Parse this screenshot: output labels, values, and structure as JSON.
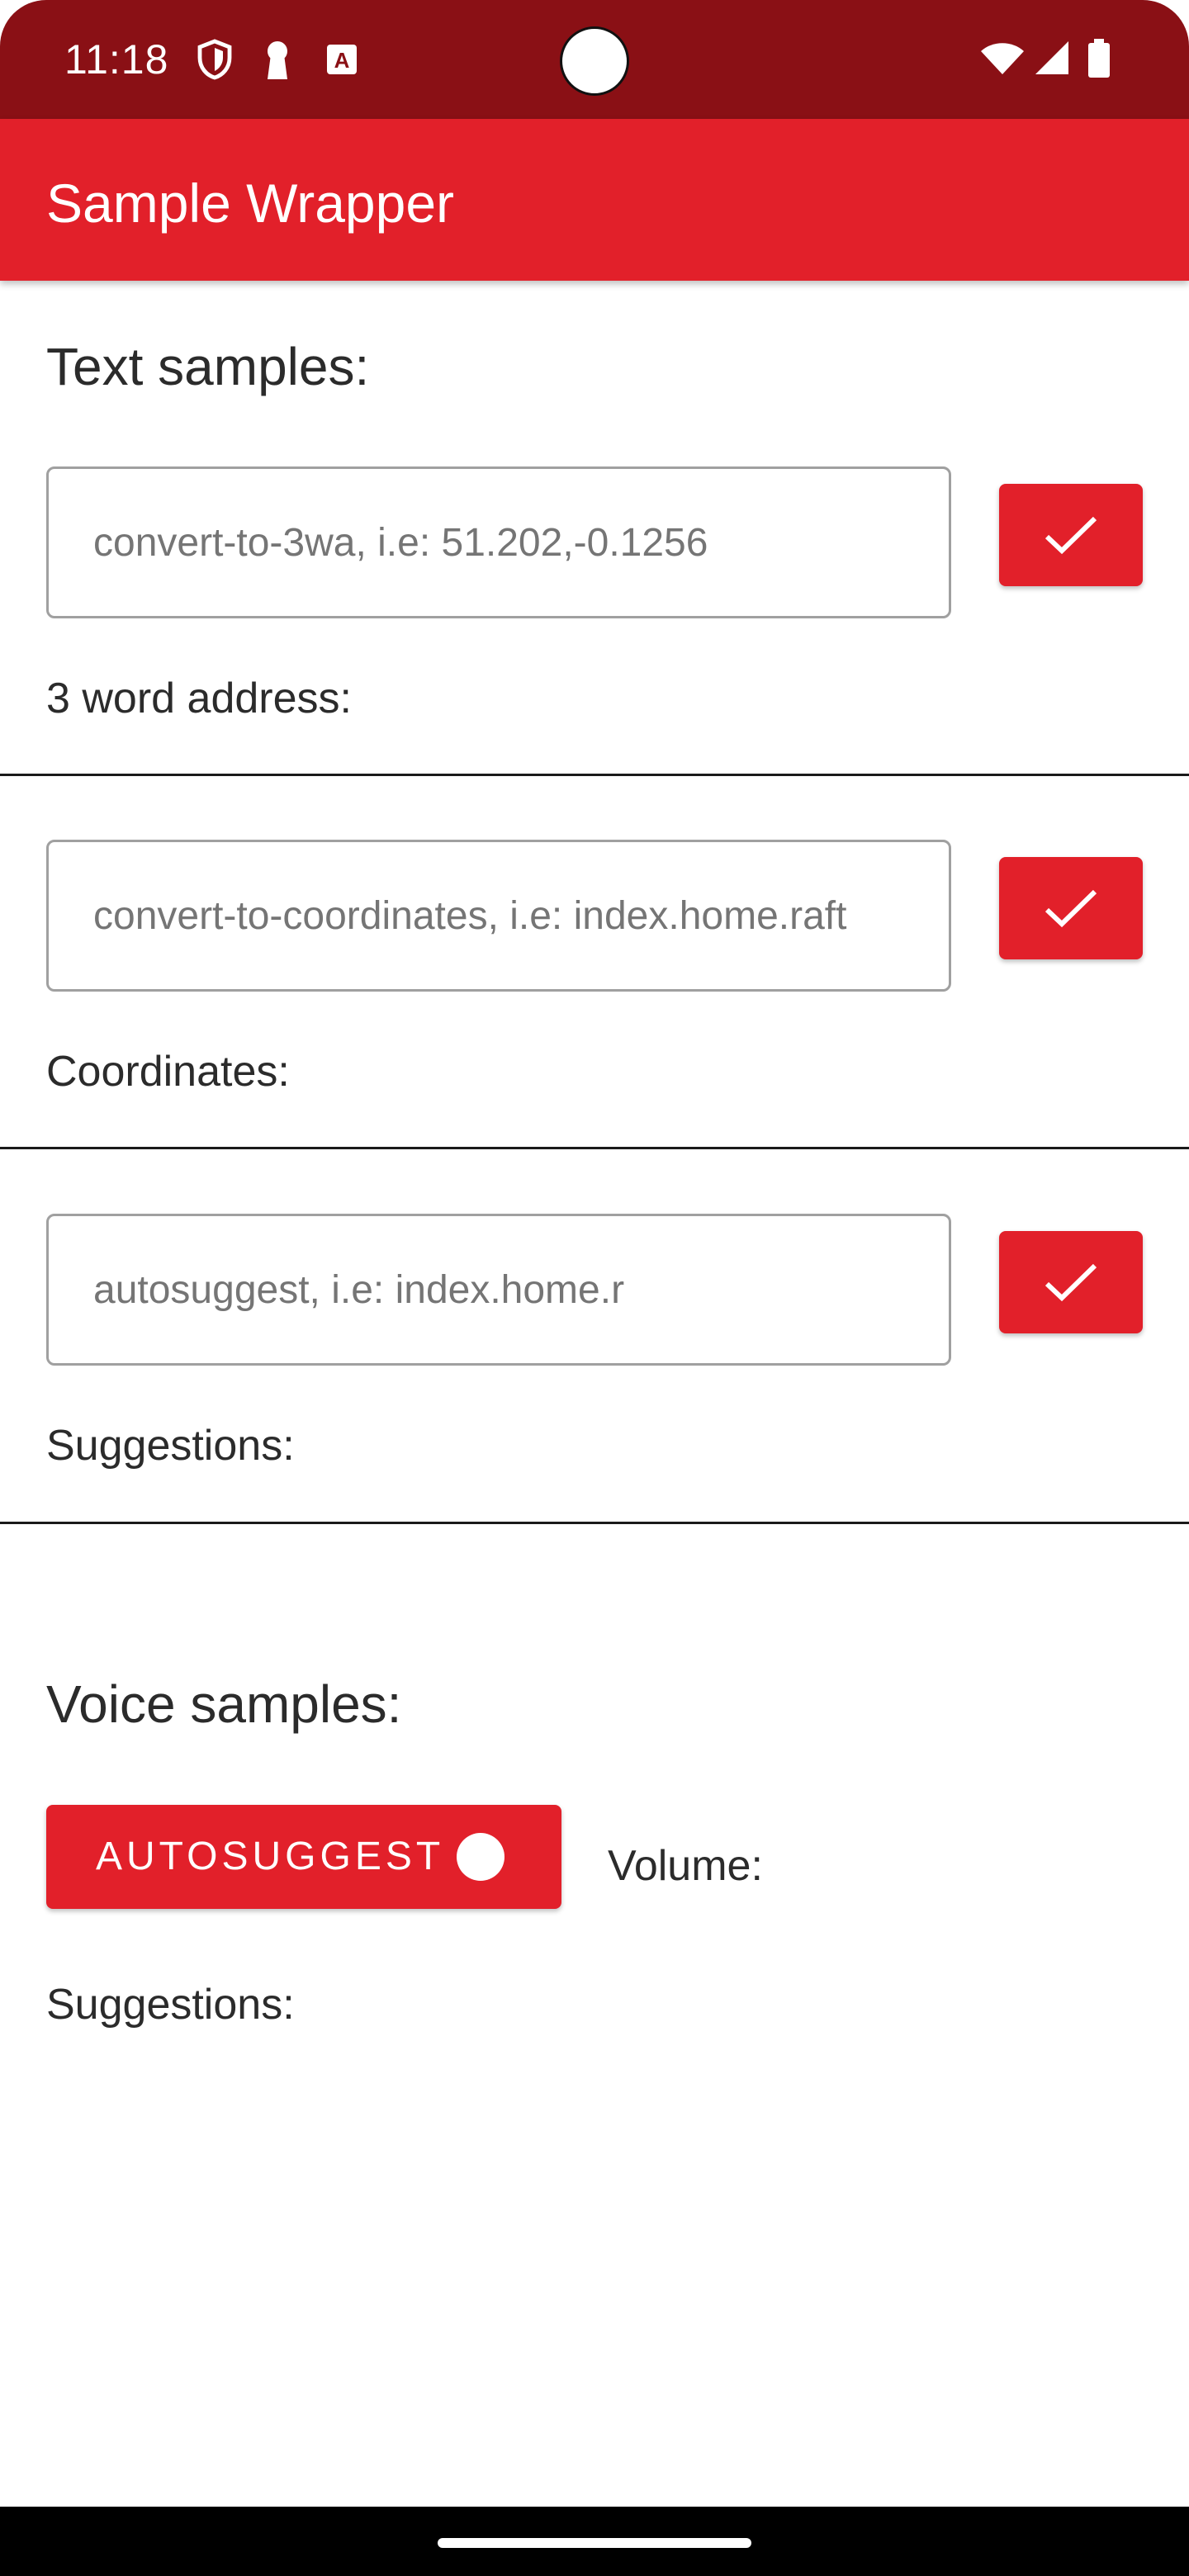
{
  "status_bar": {
    "time": "11:18",
    "left_icons": [
      "shield-icon",
      "keyhole-icon",
      "a-icon"
    ],
    "right_icons": [
      "wifi-icon",
      "signal-icon",
      "battery-icon"
    ]
  },
  "app_bar": {
    "title": "Sample Wrapper"
  },
  "text_samples": {
    "heading": "Text samples:",
    "rows": [
      {
        "input_placeholder": "convert-to-3wa, i.e: 51.202,-0.1256",
        "input_value": "",
        "button_icon": "check-icon",
        "result_label": "3 word address:"
      },
      {
        "input_placeholder": "convert-to-coordinates, i.e: index.home.raft",
        "input_value": "",
        "button_icon": "check-icon",
        "result_label": "Coordinates:"
      },
      {
        "input_placeholder": "autosuggest, i.e: index.home.r",
        "input_value": "",
        "button_icon": "check-icon",
        "result_label": "Suggestions:"
      }
    ]
  },
  "voice_samples": {
    "heading": "Voice samples:",
    "toggle_label": "AUTOSUGGEST",
    "toggle_on": false,
    "volume_label": "Volume:",
    "suggestions_label": "Suggestions:"
  },
  "colors": {
    "status_bar": "#8a1015",
    "accent": "#e2202a",
    "text": "#2b2b2b",
    "placeholder": "#757575"
  }
}
